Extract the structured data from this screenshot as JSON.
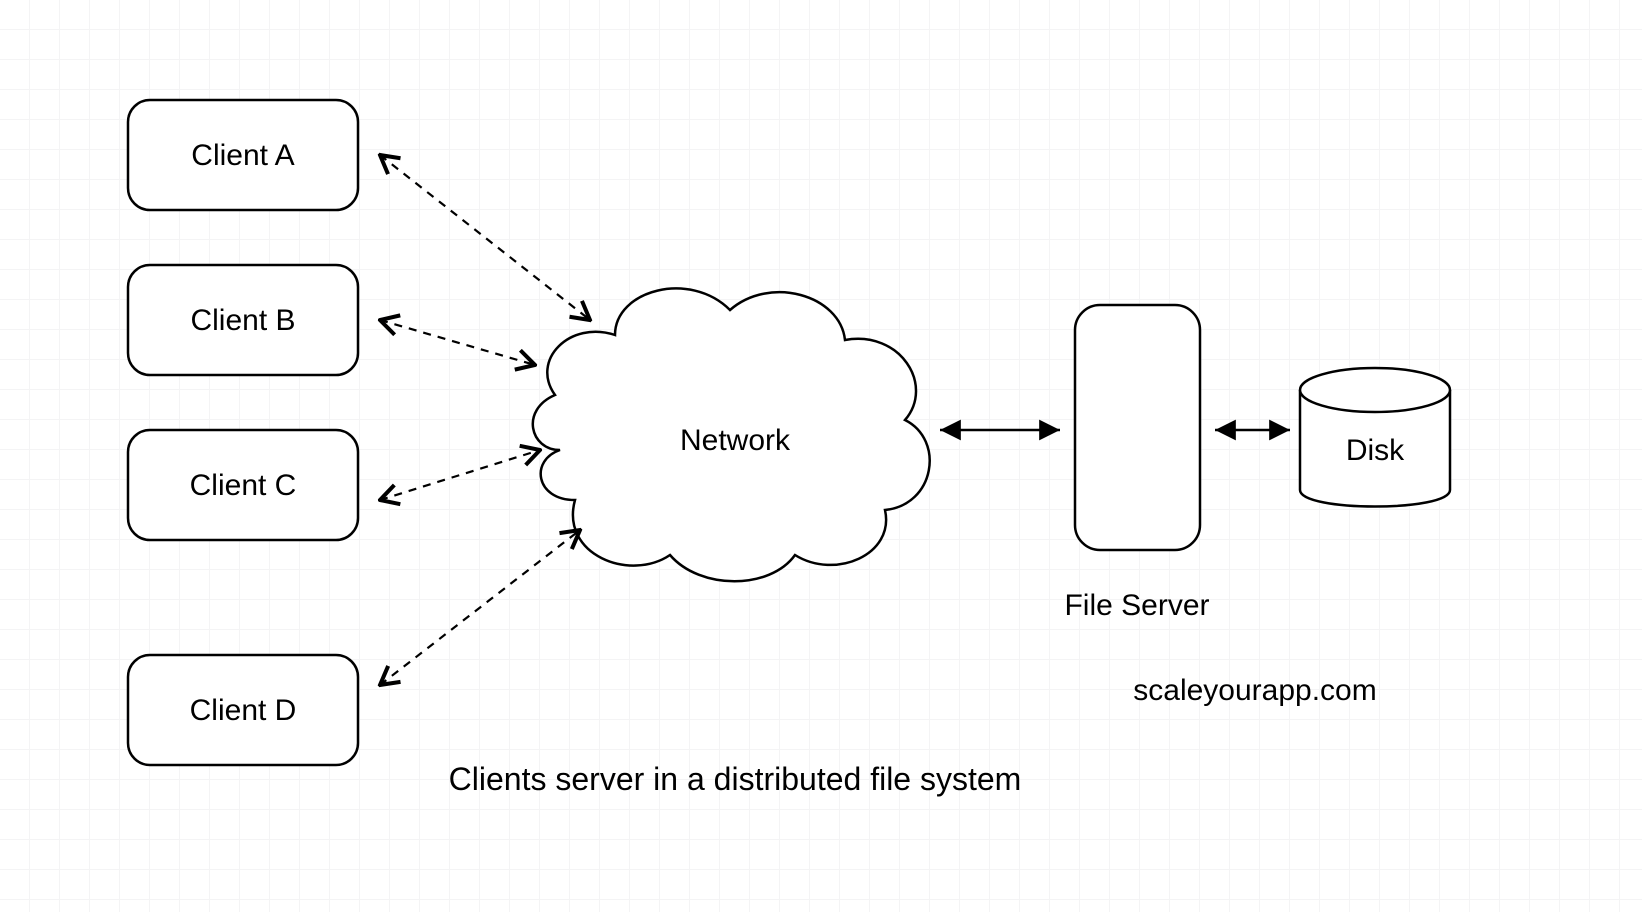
{
  "clients": {
    "a": "Client A",
    "b": "Client B",
    "c": "Client C",
    "d": "Client D"
  },
  "network_label": "Network",
  "file_server_label": "File Server",
  "disk_label": "Disk",
  "caption": "Clients server in a distributed file system",
  "attribution": "scaleyourapp.com"
}
